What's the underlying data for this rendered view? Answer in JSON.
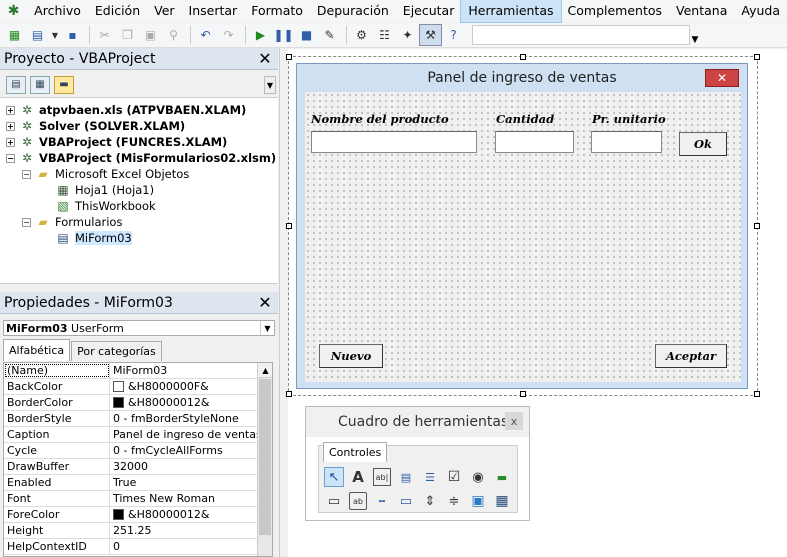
{
  "menubar": {
    "items": [
      "Archivo",
      "Edición",
      "Ver",
      "Insertar",
      "Formato",
      "Depuración",
      "Ejecutar",
      "Herramientas",
      "Complementos",
      "Ventana",
      "Ayuda"
    ],
    "active_index": 7
  },
  "toolbar": {
    "icons": [
      "excel-icon",
      "insert-userform-icon",
      "dropdown-icon",
      "save-icon",
      "cut-icon",
      "copy-icon",
      "paste-icon",
      "find-icon",
      "undo-icon",
      "redo-icon",
      "run-icon",
      "break-icon",
      "reset-icon",
      "design-mode-icon",
      "project-explorer-icon",
      "properties-icon",
      "object-browser-icon",
      "toolbox-icon",
      "help-icon"
    ]
  },
  "project_panel": {
    "title": "Proyecto - VBAProject",
    "tree": [
      {
        "label": "atpvbaen.xls (ATPVBAEN.XLAM)",
        "level": 0,
        "expander": "+",
        "icon": "vba-project-icon",
        "bold": true
      },
      {
        "label": "Solver (SOLVER.XLAM)",
        "level": 0,
        "expander": "+",
        "icon": "vba-project-icon",
        "bold": true
      },
      {
        "label": "VBAProject (FUNCRES.XLAM)",
        "level": 0,
        "expander": "+",
        "icon": "vba-project-icon",
        "bold": true
      },
      {
        "label": "VBAProject (MisFormularios02.xlsm)",
        "level": 0,
        "expander": "−",
        "icon": "vba-project-icon",
        "bold": true
      },
      {
        "label": "Microsoft Excel Objetos",
        "level": 1,
        "expander": "−",
        "icon": "folder-icon",
        "bold": false
      },
      {
        "label": "Hoja1 (Hoja1)",
        "level": 2,
        "expander": "",
        "icon": "worksheet-icon",
        "bold": false
      },
      {
        "label": "ThisWorkbook",
        "level": 2,
        "expander": "",
        "icon": "workbook-icon",
        "bold": false
      },
      {
        "label": "Formularios",
        "level": 1,
        "expander": "−",
        "icon": "folder-icon",
        "bold": false
      },
      {
        "label": "MiForm03",
        "level": 2,
        "expander": "",
        "icon": "userform-icon",
        "bold": false,
        "selected": true
      }
    ]
  },
  "properties_panel": {
    "title": "Propiedades - MiForm03",
    "object_name": "MiForm03",
    "object_type": "UserForm",
    "tabs": [
      "Alfabética",
      "Por categorías"
    ],
    "active_tab": 0,
    "rows": [
      {
        "name": "(Name)",
        "value": "MiForm03"
      },
      {
        "name": "BackColor",
        "value": "&H8000000F&",
        "swatch": "#ffffff"
      },
      {
        "name": "BorderColor",
        "value": "&H80000012&",
        "swatch": "#000000"
      },
      {
        "name": "BorderStyle",
        "value": "0 - fmBorderStyleNone"
      },
      {
        "name": "Caption",
        "value": "Panel de ingreso de ventas"
      },
      {
        "name": "Cycle",
        "value": "0 - fmCycleAllForms"
      },
      {
        "name": "DrawBuffer",
        "value": "32000"
      },
      {
        "name": "Enabled",
        "value": "True"
      },
      {
        "name": "Font",
        "value": "Times New Roman"
      },
      {
        "name": "ForeColor",
        "value": "&H80000012&",
        "swatch": "#000000"
      },
      {
        "name": "Height",
        "value": "251.25"
      },
      {
        "name": "HelpContextID",
        "value": "0"
      }
    ]
  },
  "userform": {
    "caption": "Panel de ingreso de ventas",
    "close_label": "✕",
    "labels": {
      "producto": "Nombre del producto",
      "cantidad": "Cantidad",
      "precio": "Pr. unitario"
    },
    "buttons": {
      "ok": "Ok",
      "nuevo": "Nuevo",
      "aceptar": "Aceptar"
    }
  },
  "toolbox": {
    "title": "Cuadro de herramientas",
    "close_label": "x",
    "tab": "Controles",
    "tools": [
      "select-objects-icon",
      "label-icon",
      "textbox-icon",
      "combobox-icon",
      "listbox-icon",
      "checkbox-icon",
      "optionbutton-icon",
      "togglebutton-icon",
      "frame-icon",
      "commandbutton-icon",
      "tabstrip-icon",
      "multipage-icon",
      "scrollbar-icon",
      "spinbutton-icon",
      "image-icon",
      "refedit-icon"
    ],
    "tool_glyphs": [
      "↖",
      "A",
      "ab|",
      "▤",
      "☰",
      "☑",
      "◉",
      "▬",
      "▭",
      "ab",
      "╍",
      "▭",
      "⇕",
      "≑",
      "▣",
      "▦"
    ]
  }
}
